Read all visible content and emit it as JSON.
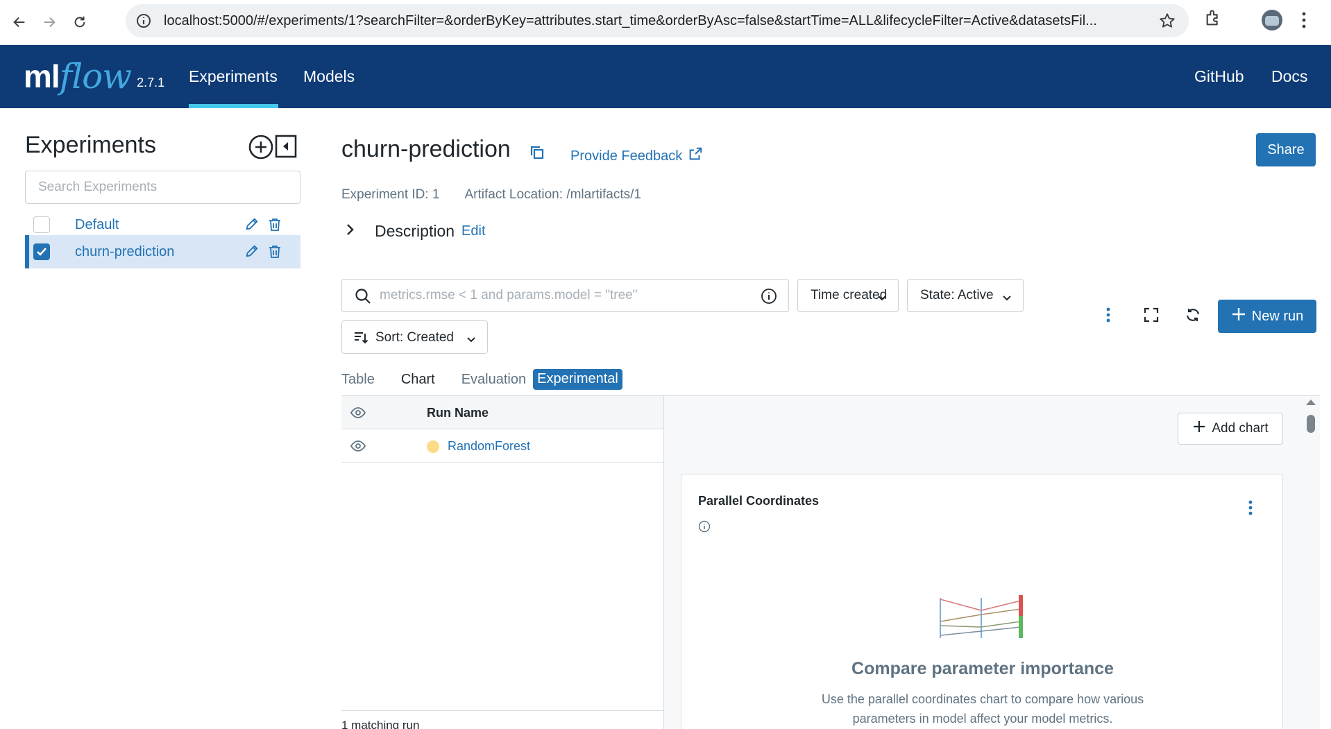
{
  "browser": {
    "url": "localhost:5000/#/experiments/1?searchFilter=&orderByKey=attributes.start_time&orderByAsc=false&startTime=ALL&lifecycleFilter=Active&datasetsFil..."
  },
  "header": {
    "logo_ml": "ml",
    "logo_flow": "flow",
    "version": "2.7.1",
    "nav": [
      "Experiments",
      "Models"
    ],
    "right_links": [
      "GitHub",
      "Docs"
    ],
    "colors": {
      "bar": "#0e3a75",
      "accent": "#43c9ed"
    }
  },
  "sidebar": {
    "title": "Experiments",
    "search_placeholder": "Search Experiments",
    "items": [
      {
        "label": "Default",
        "checked": false
      },
      {
        "label": "churn-prediction",
        "checked": true
      }
    ]
  },
  "main": {
    "title": "churn-prediction",
    "feedback_label": "Provide Feedback",
    "share_label": "Share",
    "experiment_id": "Experiment ID: 1",
    "artifact_location": "Artifact Location: /mlartifacts/1",
    "description_label": "Description",
    "description_edit": "Edit",
    "filter_placeholder": "metrics.rmse < 1 and params.model = \"tree\"",
    "time_filter": "Time created",
    "state_filter": "State: Active",
    "sort_label": "Sort: Created",
    "new_run_label": "New run",
    "tabs": [
      "Table",
      "Chart",
      "Evaluation"
    ],
    "experimental_badge": "Experimental",
    "active_tab": "Chart"
  },
  "runs": {
    "column_header": "Run Name",
    "rows": [
      {
        "name": "RandomForest",
        "color": "#fddb87"
      }
    ],
    "count_label": "1 matching run"
  },
  "charts": {
    "add_chart_label": "Add chart",
    "card_title": "Parallel Coordinates",
    "empty_title": "Compare parameter importance",
    "empty_description": "Use the parallel coordinates chart to compare how various parameters in model affect your model metrics."
  }
}
